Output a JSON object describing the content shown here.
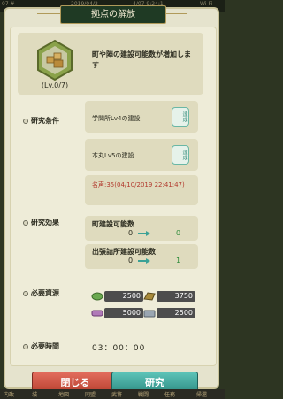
{
  "status_bar": {
    "left": "07 #",
    "center": "2019/04/2",
    "time": "4/07 9:24:1",
    "right": "Wi-Fi"
  },
  "title": "拠点の解放",
  "header": {
    "level": "(Lv.0/7)",
    "description": "町や陣の建設可能数が増加します"
  },
  "conditions": {
    "label": "研究条件",
    "items": [
      {
        "text": "学問所Lv4の建設",
        "stamp": "達成"
      },
      {
        "text": "本丸Lv5の建設",
        "stamp": "達成"
      }
    ],
    "note": "名声:35(04/10/2019 22:41:47)"
  },
  "effects": {
    "label": "研究効果",
    "items": [
      {
        "title": "町建設可能数",
        "from": "0",
        "to": "0"
      },
      {
        "title": "出張詰所建設可能数",
        "from": "0",
        "to": "1"
      }
    ]
  },
  "resources": {
    "label": "必要資源",
    "items": [
      {
        "icon": "wood-icon",
        "value": "2500",
        "color": "#6aa84f"
      },
      {
        "icon": "ore-icon",
        "value": "3750",
        "color": "#a88a3a"
      },
      {
        "icon": "cloth-icon",
        "value": "5000",
        "color": "#b07ab8"
      },
      {
        "icon": "stone-icon",
        "value": "2500",
        "color": "#9aa6b2"
      }
    ]
  },
  "time": {
    "label": "必要時間",
    "value": "03：00：00"
  },
  "buttons": {
    "close": "閉じる",
    "research": "研究"
  },
  "bottom_nav": [
    "内政",
    "城",
    "地図",
    "同盟",
    "武将",
    "戦闘",
    "任務",
    "帰還"
  ],
  "colors": {
    "accent_green": "#2f8c3a",
    "close": "#c94b3a",
    "research": "#3aa196"
  }
}
